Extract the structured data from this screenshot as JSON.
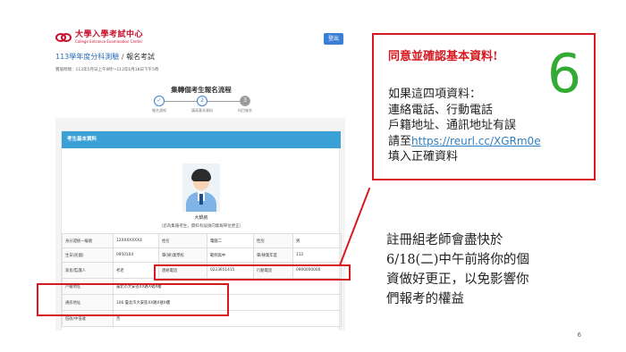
{
  "screenshot": {
    "logo": {
      "cn": "大學入學考試中心",
      "en": "College Entrance Examination Center"
    },
    "logout_label": "登出",
    "title_main": "113學年度分科測驗",
    "title_sep": " / ",
    "title_sub": "報名考試",
    "period": "實施時間：113年5月日上午9時～113年6月18日下午5時",
    "flow_title": "集轉個考生報名流程",
    "steps": [
      {
        "num": "✓",
        "label": "報名須知"
      },
      {
        "num": "2",
        "label": "填寫基本資料"
      },
      {
        "num": "3",
        "label": "科目報名"
      }
    ],
    "card_title": "考生基本資料",
    "student_name": "大鍋房",
    "student_note": "（您為集報考生，資料有誤請向集報單位更正）",
    "table": {
      "row1": [
        "身分證統一編號",
        "12XXXXXXX4",
        "姓名",
        "電腦二",
        "性別",
        "男"
      ],
      "row2": [
        "生日(民國)",
        "0950104",
        "畢(肄)業學校",
        "範例高中",
        "畢/肄業年度",
        "112"
      ],
      "row3": [
        "家長/監護人",
        "考老",
        "連絡電話",
        "0223651415",
        "行動電話",
        "0900000000"
      ],
      "row4": [
        "戶籍地址",
        "臺北市大安區XX路X號X樓"
      ],
      "row5": [
        "通訊地址",
        "106 臺北市大安區XX路X號X樓"
      ],
      "row6": [
        "低收/中低收",
        "否"
      ]
    }
  },
  "callout": {
    "title": "同意並確認基本資料!",
    "number": "6",
    "line1": "如果這四項資料：",
    "line2": "連絡電話、行動電話",
    "line3": "戶籍地址、通訊地址有誤",
    "line4_prefix": "請至",
    "link": "https://reurl.cc/XGRm0e",
    "line5": "填入正確資料"
  },
  "note": {
    "line1": "註冊組老師會盡快於",
    "line2": "6/18(二)中午前將你的個",
    "line3": "資做好更正，以免影響你",
    "line4": "們報考的權益"
  },
  "page_number": "6",
  "colors": {
    "highlight_red": "#d7191f",
    "number_green": "#33aa33",
    "header_blue": "#3aa0d6",
    "link_blue": "#2f7ec0"
  }
}
